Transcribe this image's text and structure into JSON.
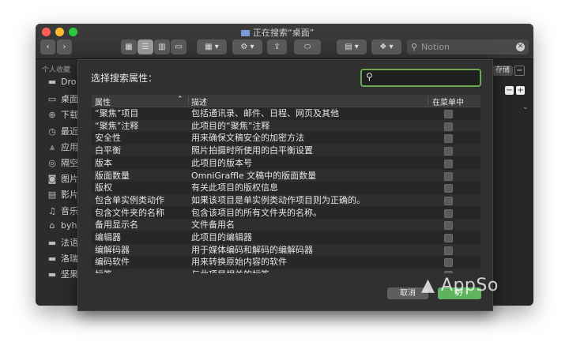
{
  "window": {
    "title": "正在搜索“桌面”",
    "search_placeholder": "Notion",
    "colors": {
      "close": "#ff5f57",
      "minimize": "#febc2e",
      "zoom": "#28c840"
    }
  },
  "toolbar": {
    "back_icon": "chevron-left",
    "forward_icon": "chevron-right",
    "view_icons": [
      "icon-view",
      "list-view",
      "column-view",
      "gallery-view"
    ],
    "group_icon": "group-icon",
    "action_icon": "gear-icon",
    "share_icon": "share-icon",
    "tag_icon": "tag-icon",
    "dropbox_icon": "dropbox-icon"
  },
  "sidebar": {
    "heading": "个人收藏",
    "items": [
      {
        "label": "Dro",
        "icon": "folder-icon"
      },
      {
        "label": "桌面",
        "icon": "desktop-icon"
      },
      {
        "label": "下载",
        "icon": "download-icon"
      },
      {
        "label": "最近",
        "icon": "clock-icon"
      },
      {
        "label": "应用",
        "icon": "applications-icon"
      },
      {
        "label": "隔空",
        "icon": "airdrop-icon"
      },
      {
        "label": "图片",
        "icon": "camera-icon"
      },
      {
        "label": "影片",
        "icon": "film-icon"
      },
      {
        "label": "音乐",
        "icon": "music-icon"
      },
      {
        "label": "byh",
        "icon": "home-icon"
      },
      {
        "label": "法语",
        "icon": "folder-icon"
      },
      {
        "label": "洛瑞",
        "icon": "folder-icon"
      },
      {
        "label": "坚果",
        "icon": "folder-icon"
      }
    ]
  },
  "right_strip": {
    "save_label": "存储"
  },
  "sheet": {
    "label": "选择搜索属性：",
    "columns": {
      "attr": "属性",
      "desc": "描述",
      "menu": "在菜单中"
    },
    "rows": [
      {
        "attr": "“聚焦”项目",
        "desc": "包括通讯录、邮件、日程、网页及其他"
      },
      {
        "attr": "“聚焦”注释",
        "desc": "此项目的“聚焦”注释"
      },
      {
        "attr": "安全性",
        "desc": "用来确保文稿安全的加密方法"
      },
      {
        "attr": "白平衡",
        "desc": "照片拍摄时所使用的白平衡设置"
      },
      {
        "attr": "版本",
        "desc": "此项目的版本号"
      },
      {
        "attr": "版面数量",
        "desc": "OmniGraffle 文稿中的版面数量"
      },
      {
        "attr": "版权",
        "desc": "有关此项目的版权信息"
      },
      {
        "attr": "包含单实例类动作",
        "desc": "如果该项目是单实例类动作项目则为正确的。"
      },
      {
        "attr": "包含文件夹的名称",
        "desc": "包含该项目的所有文件夹的名称。"
      },
      {
        "attr": "备用显示名",
        "desc": "文件备用名"
      },
      {
        "attr": "编辑器",
        "desc": "此项目的编辑器"
      },
      {
        "attr": "编解码器",
        "desc": "用于媒体编码和解码的编解码器"
      },
      {
        "attr": "编码软件",
        "desc": "用来转换原始内容的软件"
      },
      {
        "attr": "标签",
        "desc": "与此项目相关的标签"
      }
    ],
    "cancel_label": "取消",
    "ok_label": "好",
    "accent": "#6aa84f"
  },
  "watermark": {
    "text": "AppSo"
  }
}
